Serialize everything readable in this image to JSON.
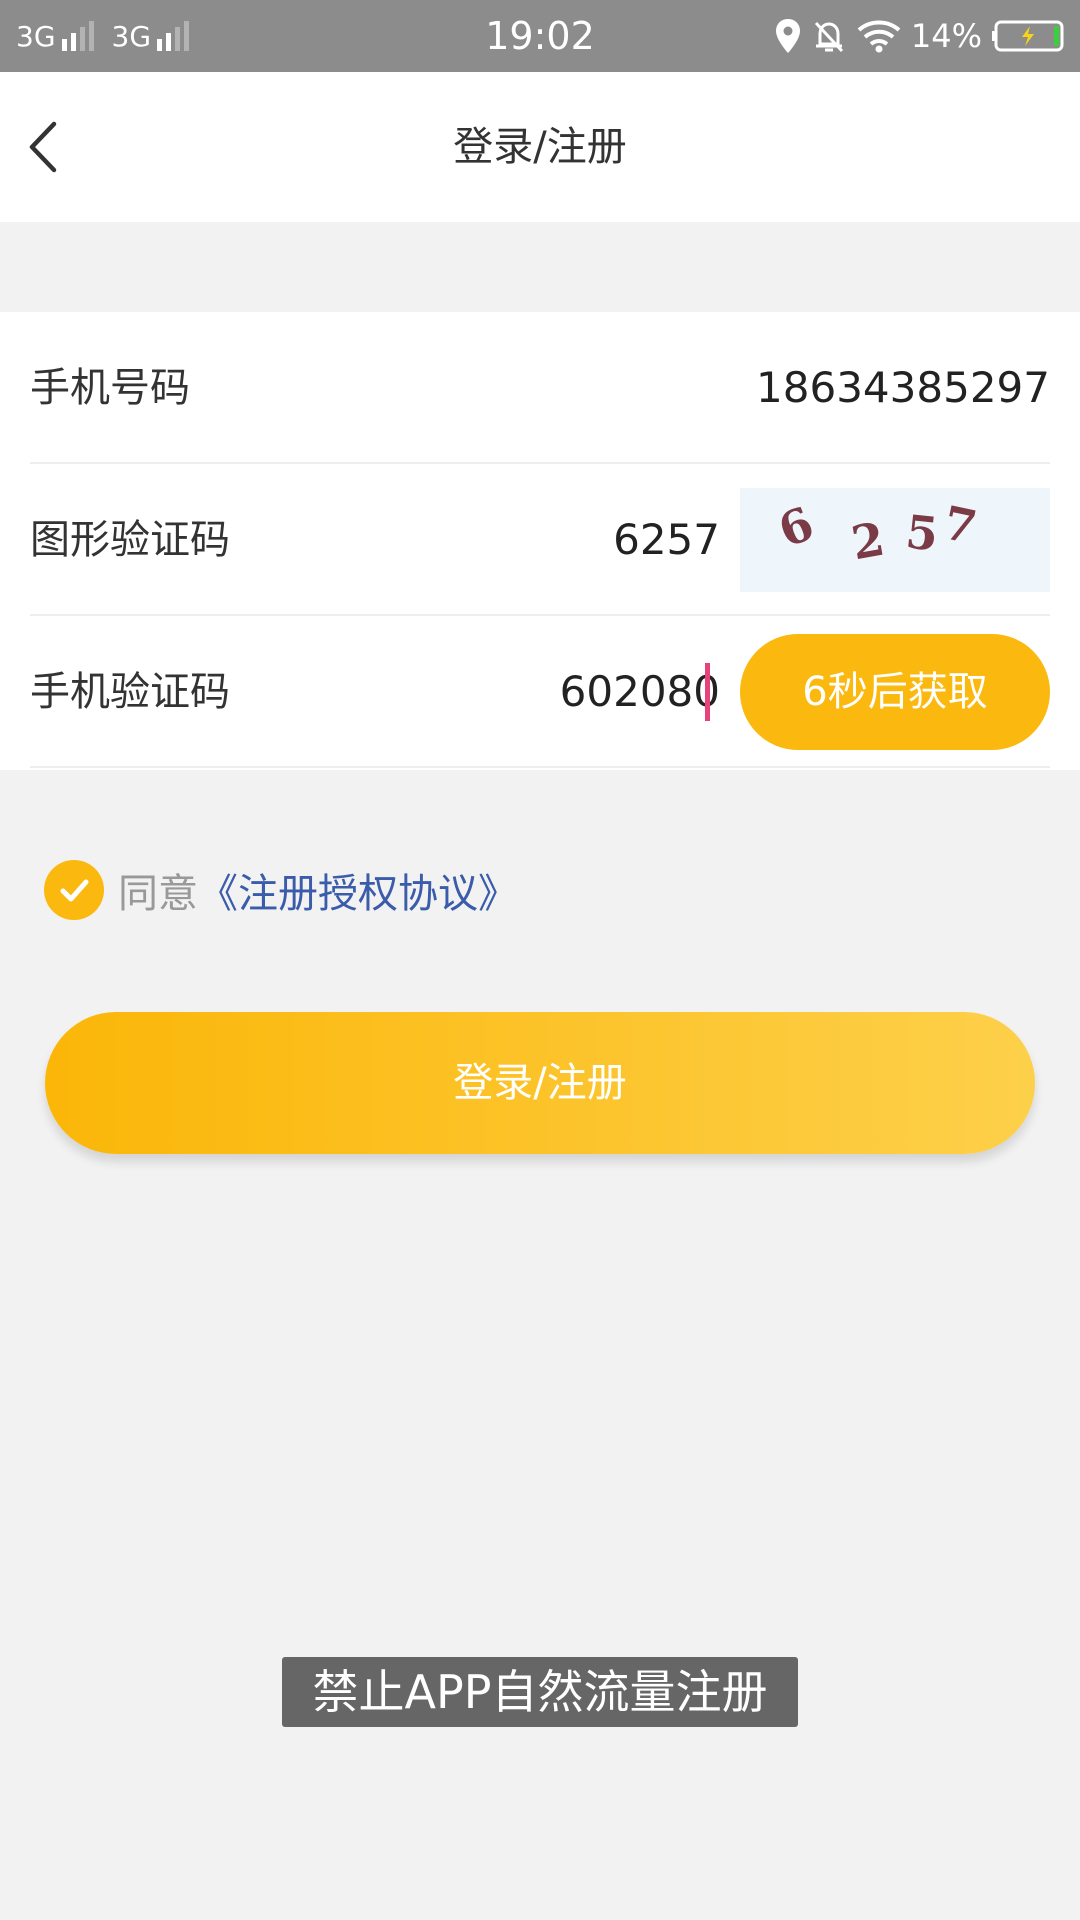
{
  "status_bar": {
    "network_1": "3G",
    "network_2": "3G",
    "time": "19:02",
    "battery": "14%",
    "icons": [
      "signal-icon",
      "location-icon",
      "alarm-off-icon",
      "wifi-icon",
      "battery-charging-icon"
    ]
  },
  "header": {
    "title": "登录/注册",
    "back_icon": "chevron-left-icon"
  },
  "form": {
    "phone": {
      "label": "手机号码",
      "value": "18634385297"
    },
    "captcha": {
      "label": "图形验证码",
      "value": "6257",
      "image_chars": [
        "6",
        "2",
        "5",
        "7"
      ]
    },
    "sms": {
      "label": "手机验证码",
      "value": "602080",
      "button_label": "6秒后获取"
    }
  },
  "agreement": {
    "checked": true,
    "prefix": "同意",
    "link": "《注册授权协议》",
    "check_icon": "check-circle-icon"
  },
  "login_button": {
    "label": "登录/注册"
  },
  "toast": {
    "message": "禁止APP自然流量注册"
  },
  "colors": {
    "accent": "#fbb80f",
    "link": "#3a5caa",
    "cursor": "#e8427c",
    "status_bar": "#8c8c8c",
    "background": "#f2f2f2"
  }
}
